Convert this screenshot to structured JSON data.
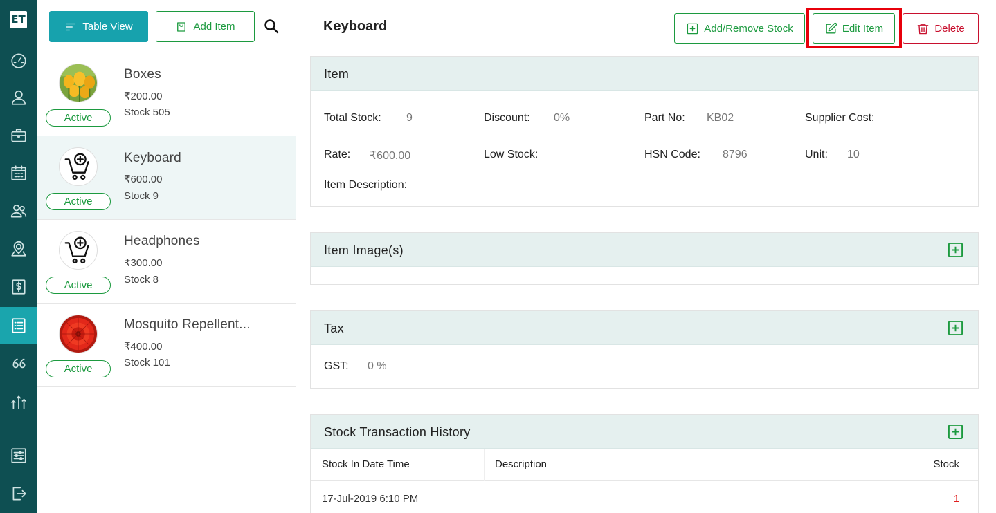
{
  "app": {
    "logo_text": "ET"
  },
  "rail": {
    "items": [
      {
        "name": "dashboard-icon"
      },
      {
        "name": "user-icon"
      },
      {
        "name": "briefcase-icon"
      },
      {
        "name": "calendar-icon"
      },
      {
        "name": "users-icon"
      },
      {
        "name": "map-pin-icon"
      },
      {
        "name": "dollar-icon"
      },
      {
        "name": "list-icon",
        "active": true
      },
      {
        "name": "quote-icon"
      },
      {
        "name": "analytics-icon"
      },
      {
        "name": "settings-sliders-icon"
      },
      {
        "name": "logout-icon"
      }
    ]
  },
  "list": {
    "table_view_label": "Table View",
    "add_item_label": "Add Item",
    "items": [
      {
        "name": "Boxes",
        "price": "₹200.00",
        "stock": "Stock 505",
        "status": "Active",
        "image": "flower-yellow"
      },
      {
        "name": "Keyboard",
        "price": "₹600.00",
        "stock": "Stock 9",
        "status": "Active",
        "image": "cart-placeholder"
      },
      {
        "name": "Headphones",
        "price": "₹300.00",
        "stock": "Stock 8",
        "status": "Active",
        "image": "cart-placeholder"
      },
      {
        "name": "Mosquito Repellent...",
        "price": "₹400.00",
        "stock": "Stock 101",
        "status": "Active",
        "image": "flower-red"
      }
    ]
  },
  "detail": {
    "title": "Keyboard",
    "add_remove_stock_label": "Add/Remove Stock",
    "edit_item_label": "Edit Item",
    "delete_label": "Delete",
    "item_section": {
      "title": "Item",
      "total_stock_label": "Total Stock:",
      "total_stock": "9",
      "discount_label": "Discount:",
      "discount": "0%",
      "part_no_label": "Part No:",
      "part_no": "KB02",
      "supplier_cost_label": "Supplier Cost:",
      "rate_label": "Rate:",
      "rate": "₹600.00",
      "low_stock_label": "Low Stock:",
      "hsn_label": "HSN Code:",
      "hsn": "8796",
      "unit_label": "Unit:",
      "unit": "10",
      "description_label": "Item Description:"
    },
    "images_section": {
      "title": "Item Image(s)"
    },
    "tax_section": {
      "title": "Tax",
      "gst_label": "GST:",
      "gst": "0 %"
    },
    "history_section": {
      "title": "Stock Transaction History",
      "columns": [
        "Stock In Date Time",
        "Description",
        "Stock"
      ],
      "rows": [
        {
          "datetime": "17-Jul-2019 6:10 PM",
          "description": "",
          "stock": "1"
        }
      ]
    }
  },
  "colors": {
    "rail_bg": "#0e4f52",
    "accent_teal": "#17a2ad",
    "green": "#1c9a3f",
    "danger": "#c8102e",
    "highlight": "#e8000b"
  }
}
